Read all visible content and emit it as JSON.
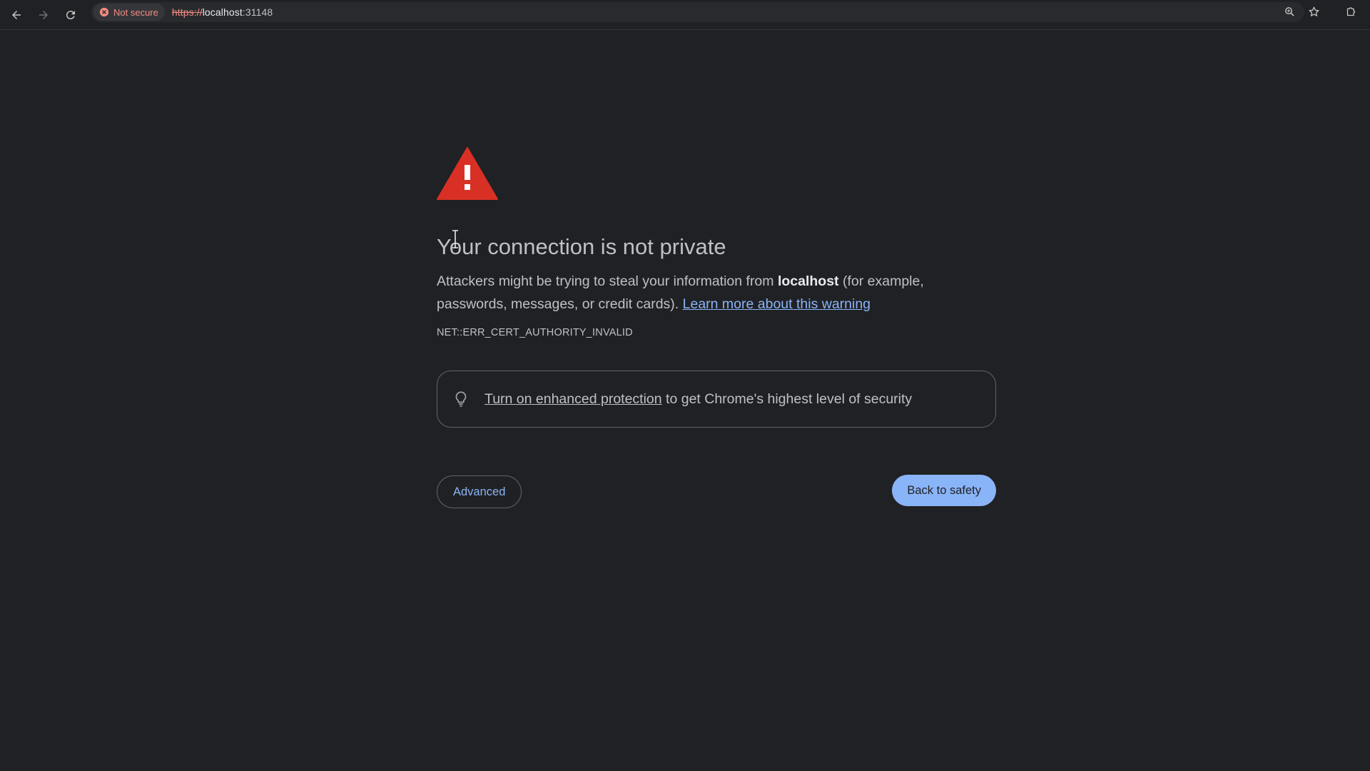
{
  "browser": {
    "security_chip": {
      "label": "Not secure",
      "icon": "error-circle-icon",
      "color": "#f28b82"
    },
    "url": {
      "scheme": "https://",
      "host": "localhost",
      "port": ":31148"
    },
    "icons": {
      "back": "arrow-back-icon",
      "forward": "arrow-forward-icon",
      "reload": "reload-icon",
      "zoom": "zoom-icon",
      "bookmark": "star-icon",
      "extensions": "puzzle-icon"
    }
  },
  "interstitial": {
    "icon": "warning-triangle-icon",
    "heading": "Your connection is not private",
    "message": {
      "prefix": "Attackers might be trying to steal your information from ",
      "hostname": "localhost",
      "suffix": " (for example, passwords, messages, or credit cards). ",
      "learn_more": "Learn more about this warning"
    },
    "error_code": "NET::ERR_CERT_AUTHORITY_INVALID",
    "promo": {
      "icon": "lightbulb-icon",
      "link_text": "Turn on enhanced protection",
      "text": " to get Chrome's highest level of security"
    },
    "buttons": {
      "advanced": "Advanced",
      "back_to_safety": "Back to safety"
    }
  },
  "colors": {
    "background": "#202124",
    "text": "#bdc1c6",
    "link": "#8ab4f8",
    "warning_red": "#d93025",
    "primary_button": "#8ab4f8"
  }
}
